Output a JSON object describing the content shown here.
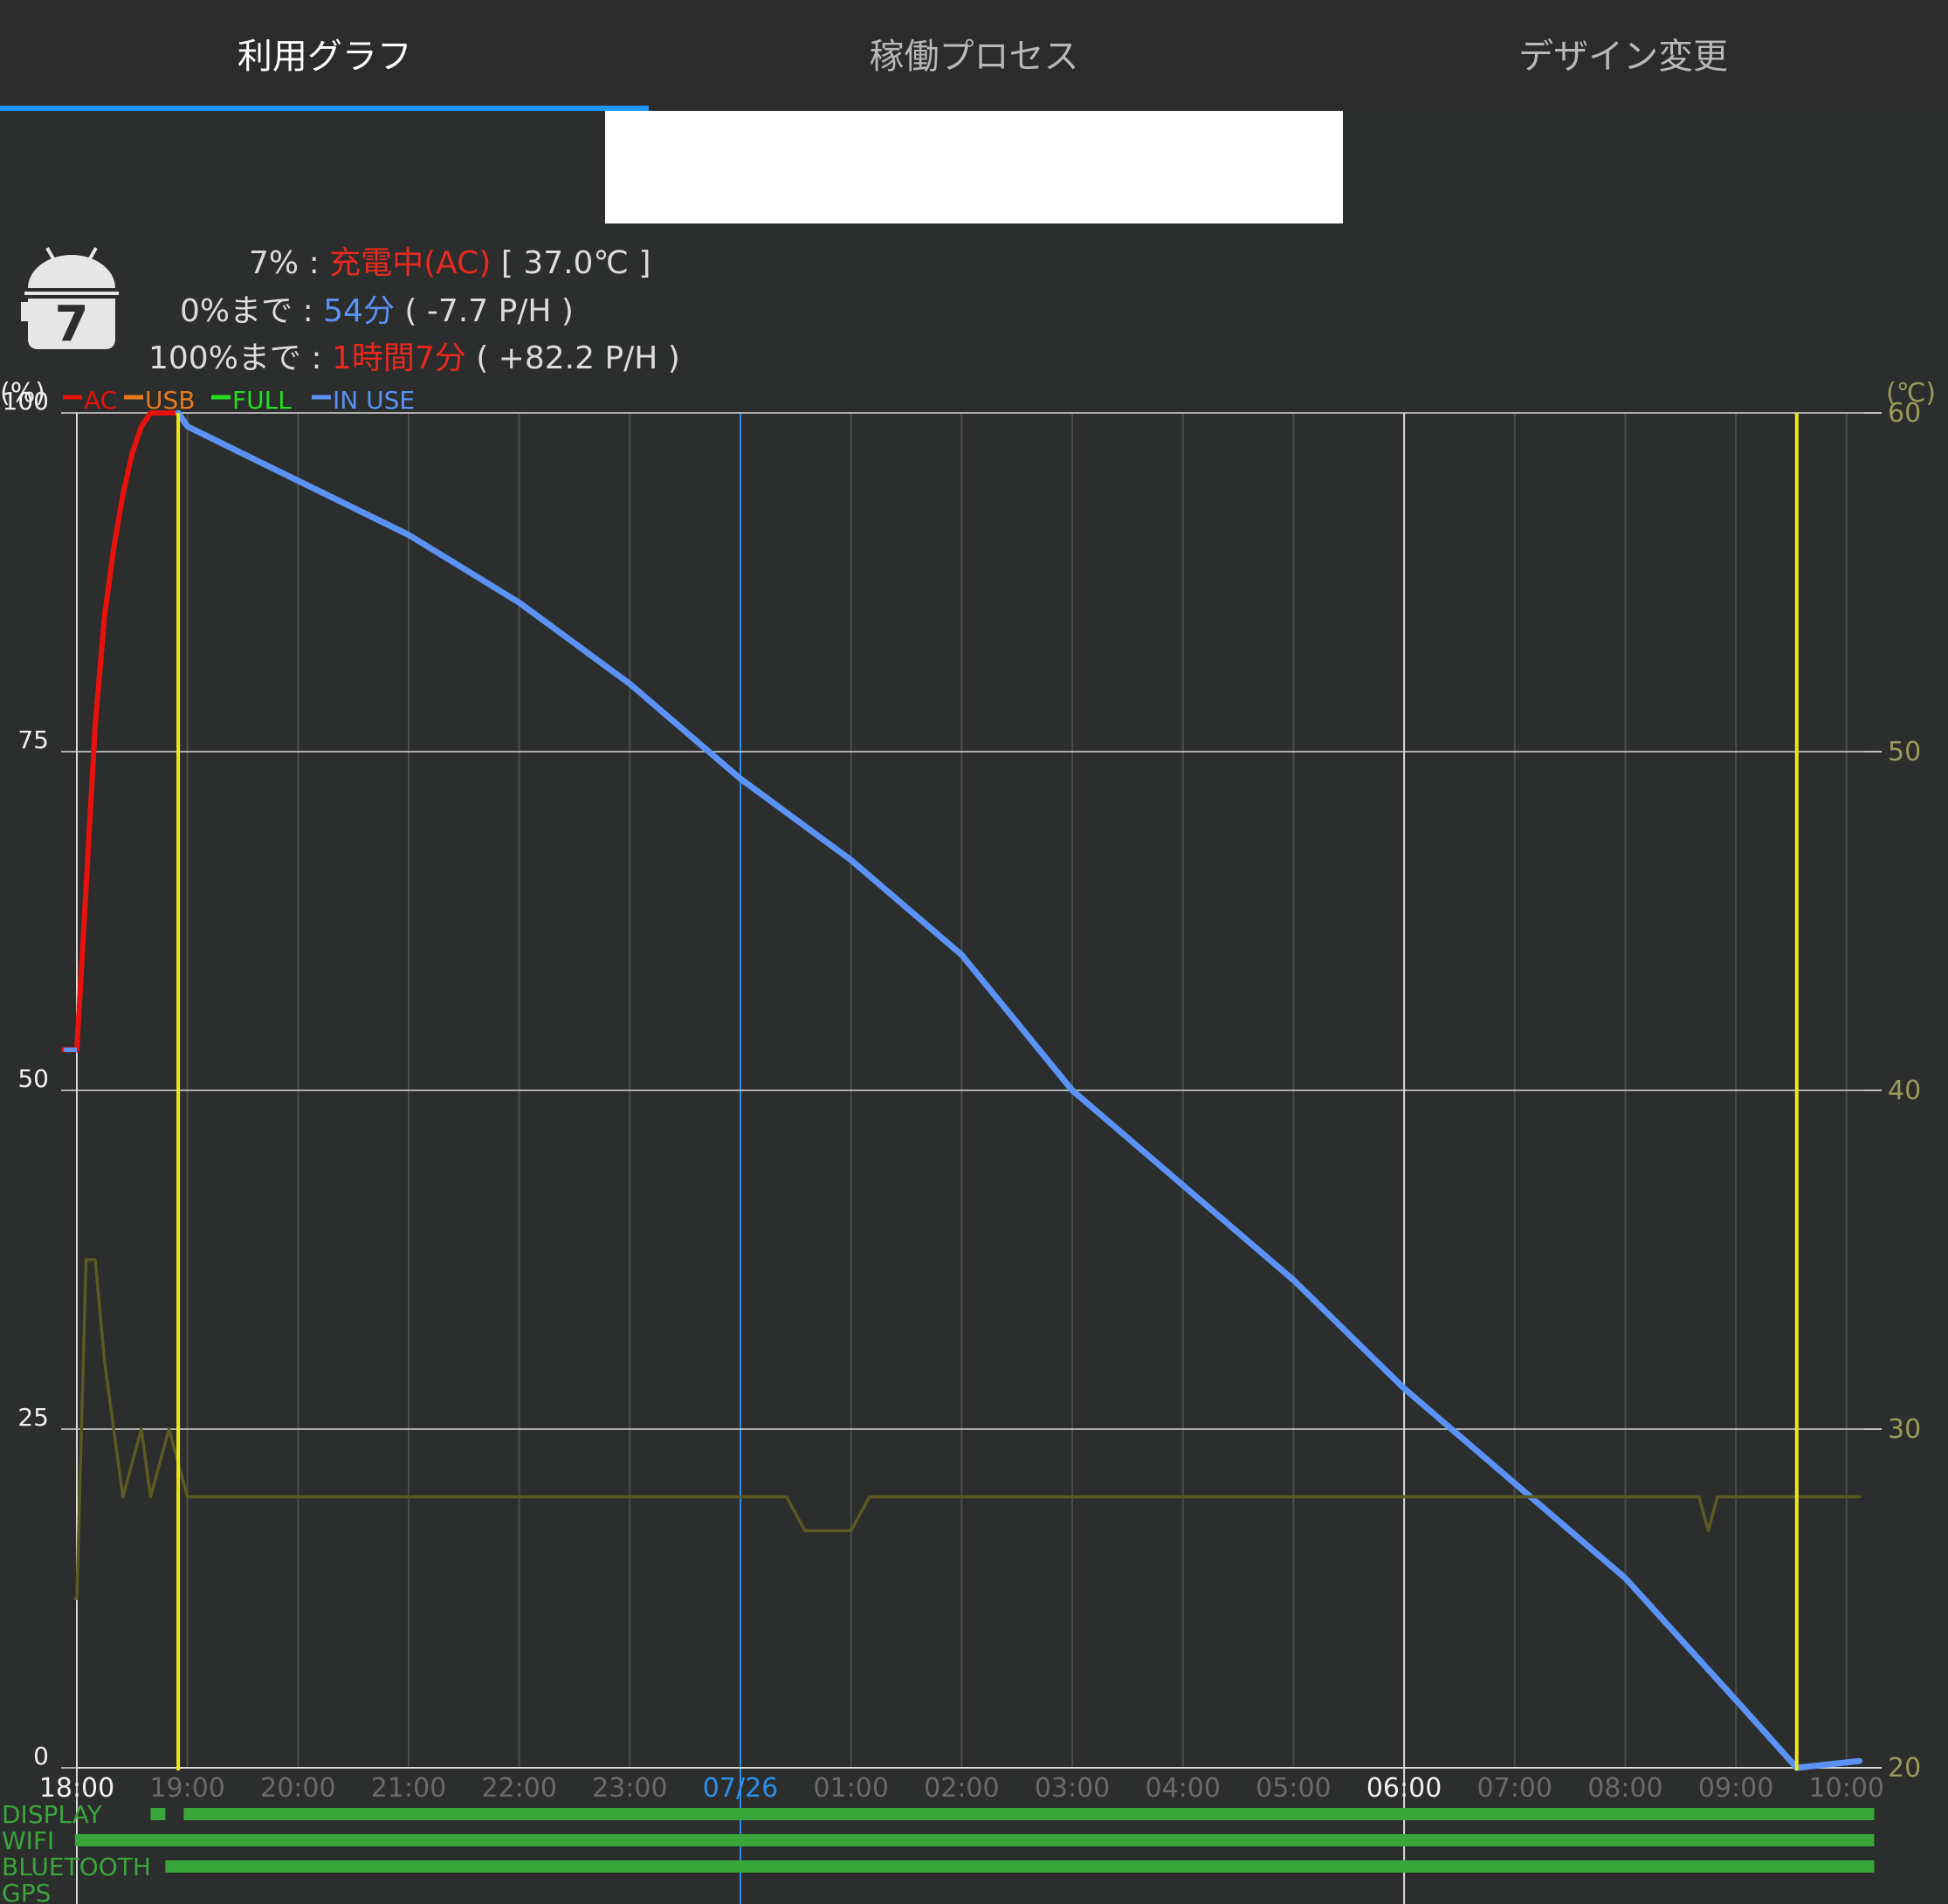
{
  "tabs": [
    {
      "label": "利用グラフ",
      "active": true
    },
    {
      "label": "稼働プロセス",
      "active": false
    },
    {
      "label": "デザイン変更",
      "active": false
    }
  ],
  "status": {
    "battery_icon_value": "7",
    "line1": {
      "percent": "7%",
      "sep": " : ",
      "state": "充電中(AC)",
      "temp": " [ 37.0℃ ]"
    },
    "line2": {
      "label": "0%まで",
      "sep": " : ",
      "time": "54分",
      "rate": " ( -7.7 P/H )"
    },
    "line3": {
      "label": "100%まで",
      "sep": " : ",
      "time": "1時間7分",
      "rate": " ( +82.2 P/H )"
    }
  },
  "colors": {
    "ac": "#e8120c",
    "usb": "#e87a1e",
    "full": "#22dd22",
    "in_use": "#5a93f5",
    "temperature": "#5a5a22",
    "charge_marker": "#f2e61a",
    "date_line": "#2a8fe8",
    "status_bar": "#3aa63a",
    "right_axis": "#9a9a5a",
    "tab_indicator": "#2196f3"
  },
  "chart_data": {
    "type": "line",
    "left_unit": "(%)",
    "right_unit": "(℃)",
    "legend": [
      "AC",
      "USB",
      "FULL",
      "IN USE"
    ],
    "y_left_ticks": [
      "100",
      "75",
      "50",
      "25",
      "0"
    ],
    "y_left_range": [
      0,
      100
    ],
    "y_right_ticks": [
      "60",
      "50",
      "40",
      "30",
      "20"
    ],
    "y_right_range": [
      20,
      60
    ],
    "x_range_hours": [
      "18:00",
      "10:20"
    ],
    "x_tick_labels": [
      "18:00",
      "19:00",
      "20:00",
      "21:00",
      "22:00",
      "23:00",
      "07/26",
      "01:00",
      "02:00",
      "03:00",
      "04:00",
      "05:00",
      "06:00",
      "07:00",
      "08:00",
      "09:00",
      "10:00"
    ],
    "series": [
      {
        "name": "AC",
        "x": [
          "17:53",
          "18:00",
          "18:05",
          "18:10",
          "18:15",
          "18:20",
          "18:25",
          "18:30",
          "18:35",
          "18:40",
          "18:45",
          "18:50",
          "18:55"
        ],
        "values": [
          53,
          53,
          65,
          77,
          85,
          90,
          94,
          97,
          99,
          100,
          100,
          100,
          100
        ]
      },
      {
        "name": "IN USE",
        "x": [
          "18:55",
          "19:00",
          "19:30",
          "20:00",
          "21:00",
          "22:00",
          "23:00",
          "00:00",
          "01:00",
          "02:00",
          "03:00",
          "04:00",
          "05:00",
          "06:00",
          "07:00",
          "08:00",
          "09:00",
          "09:33",
          "10:07"
        ],
        "values": [
          100,
          99,
          97,
          95,
          91,
          86,
          80,
          73,
          67,
          60,
          50,
          43,
          36,
          28,
          21,
          14,
          5,
          0,
          0.5
        ]
      },
      {
        "name": "temperature",
        "x": [
          "17:59",
          "18:00",
          "18:03",
          "18:05",
          "18:10",
          "18:15",
          "18:20",
          "18:25",
          "18:30",
          "18:35",
          "18:40",
          "18:45",
          "18:50",
          "18:55",
          "19:00",
          "19:10",
          "19:20",
          "00:25",
          "00:35",
          "01:00",
          "01:10",
          "08:40",
          "08:45",
          "08:50",
          "10:07"
        ],
        "values": [
          25,
          25,
          31,
          35,
          35,
          32,
          30,
          28,
          29,
          30,
          28,
          29,
          30,
          29,
          28,
          28,
          28,
          28,
          27,
          27,
          28,
          28,
          27,
          28,
          28
        ]
      }
    ],
    "charge_markers": [
      "18:55",
      "09:33"
    ],
    "date_marker": "00:00",
    "status_rows": [
      {
        "label": "DISPLAY",
        "segments": [
          [
            "18:40",
            "18:48"
          ],
          [
            "18:58",
            "10:15"
          ]
        ]
      },
      {
        "label": "WIFI",
        "segments": [
          [
            "17:59",
            "10:15"
          ]
        ]
      },
      {
        "label": "BLUETOOTH",
        "segments": [
          [
            "18:48",
            "10:15"
          ]
        ]
      },
      {
        "label": "GPS",
        "segments": []
      }
    ]
  }
}
